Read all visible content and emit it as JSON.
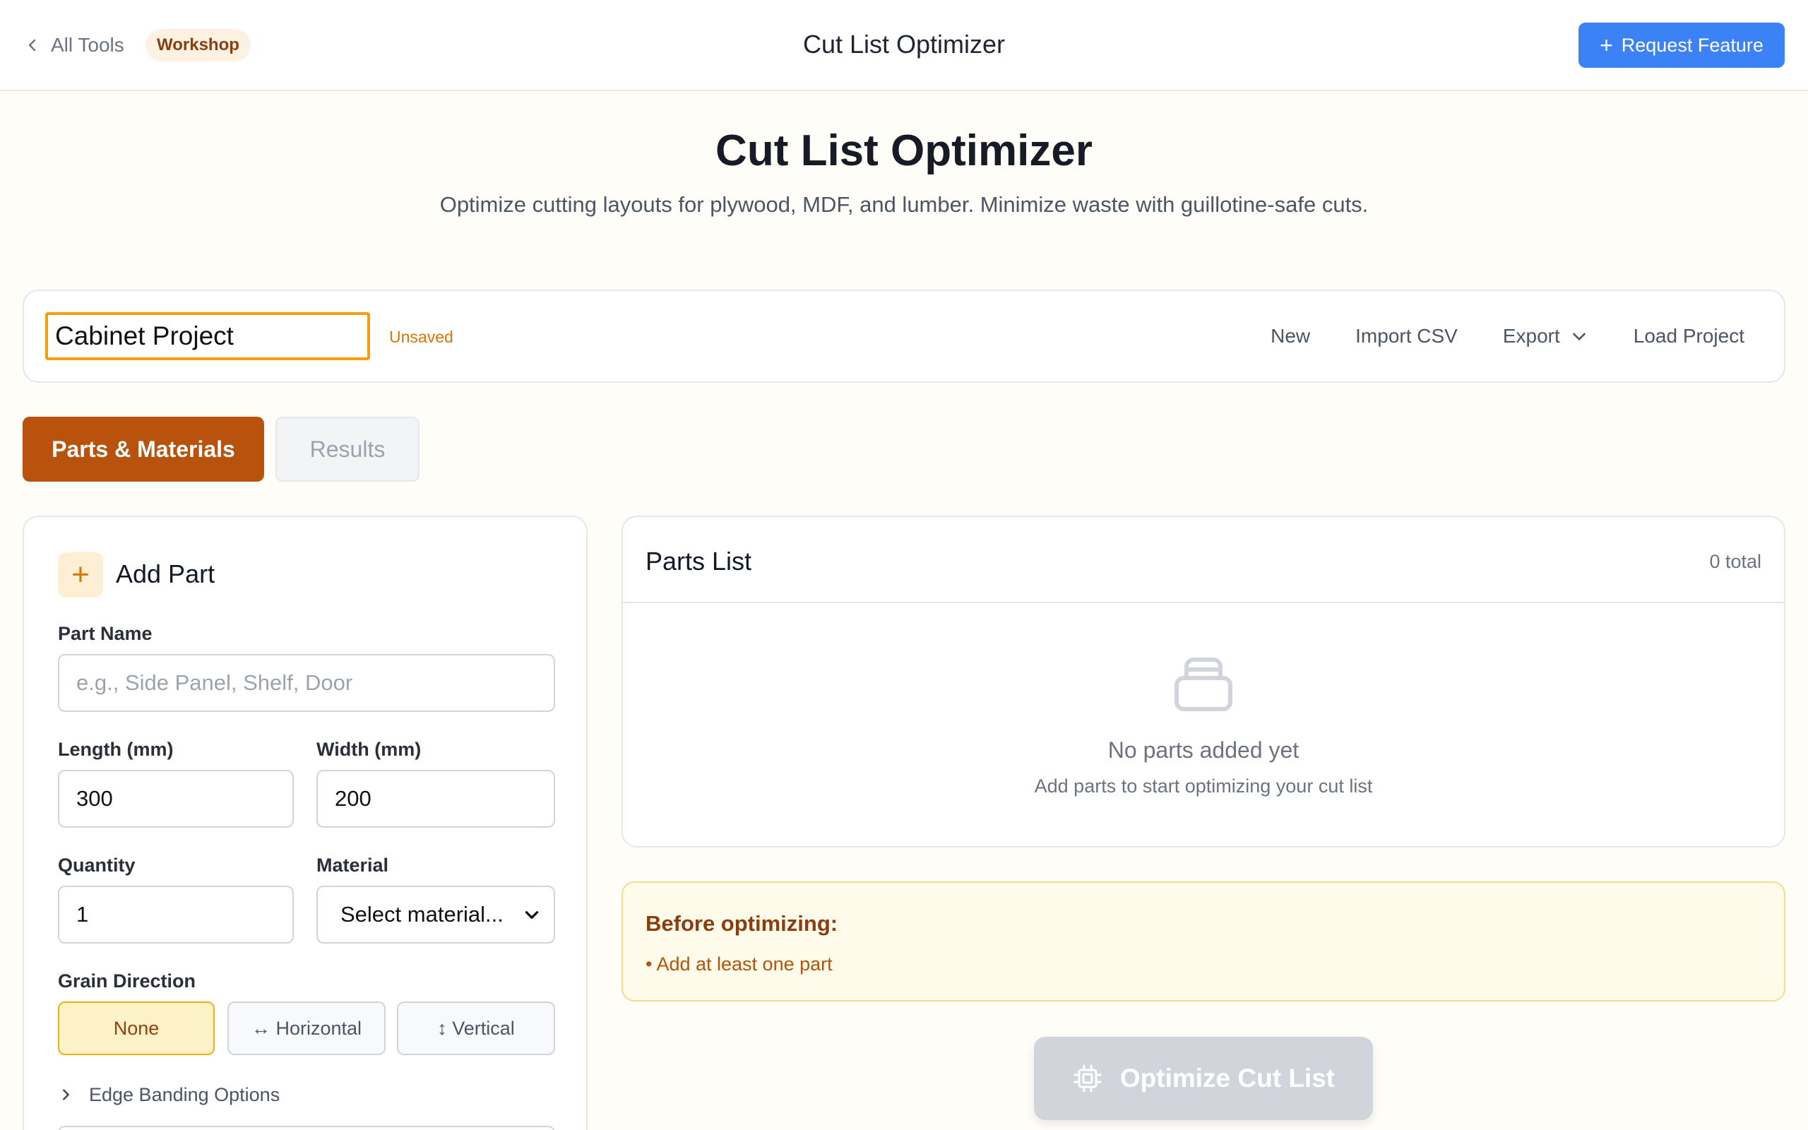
{
  "header": {
    "back_label": "All Tools",
    "category_badge": "Workshop",
    "title": "Cut List Optimizer",
    "request_button": "Request Feature"
  },
  "hero": {
    "title": "Cut List Optimizer",
    "subtitle": "Optimize cutting layouts for plywood, MDF, and lumber. Minimize waste with guillotine-safe cuts."
  },
  "project": {
    "name": "Cabinet Project",
    "status": "Unsaved",
    "actions": {
      "new": "New",
      "import_csv": "Import CSV",
      "export": "Export",
      "load": "Load Project"
    }
  },
  "tabs": [
    {
      "label": "Parts & Materials",
      "active": true
    },
    {
      "label": "Results",
      "active": false
    }
  ],
  "add_part": {
    "title": "Add Part",
    "part_name_label": "Part Name",
    "part_name_placeholder": "e.g., Side Panel, Shelf, Door",
    "length_label": "Length (mm)",
    "length_value": "300",
    "width_label": "Width (mm)",
    "width_value": "200",
    "quantity_label": "Quantity",
    "quantity_value": "1",
    "material_label": "Material",
    "material_value": "Select material...",
    "grain_label": "Grain Direction",
    "grain_options": [
      {
        "label": "None",
        "selected": true
      },
      {
        "label": "↔ Horizontal",
        "selected": false
      },
      {
        "label": "↕ Vertical",
        "selected": false
      }
    ],
    "edge_banding": "Edge Banding Options"
  },
  "parts_list": {
    "title": "Parts List",
    "count": "0 total",
    "empty_title": "No parts added yet",
    "empty_subtitle": "Add parts to start optimizing your cut list"
  },
  "notice": {
    "title": "Before optimizing:",
    "items": [
      "• Add at least one part"
    ]
  },
  "optimize_button": "Optimize Cut List",
  "colors": {
    "accent_orange": "#b9520c",
    "primary_blue": "#3b82f6",
    "warning_amber": "#f59e0b",
    "disabled_gray": "#d1d5db"
  }
}
